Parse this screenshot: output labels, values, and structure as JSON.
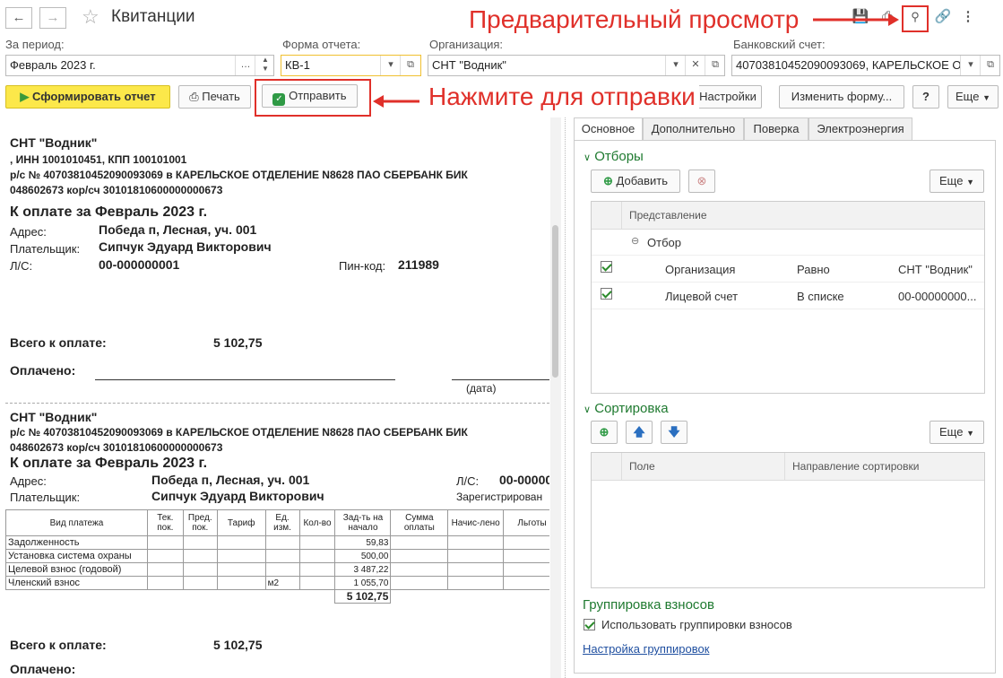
{
  "window": {
    "title": "Квитанции",
    "icons": [
      "back-arrow-icon",
      "forward-arrow-icon",
      "star-icon",
      "save-icon",
      "print-icon",
      "preview-icon",
      "link-icon",
      "more-vert-icon"
    ]
  },
  "annotations": {
    "preview": "Предварительный просмотр",
    "send": "Нажмите для отправки"
  },
  "fields": {
    "period_label": "За период:",
    "period_value": "Февраль 2023 г.",
    "form_label": "Форма отчета:",
    "form_value": "КВ-1",
    "org_label": "Организация:",
    "org_value": "СНТ \"Водник\"",
    "bank_label": "Банковский счет:",
    "bank_value": "40703810452090093069, КАРЕЛЬСКОЕ О"
  },
  "toolbar": {
    "generate": "Сформировать отчет",
    "print": "Печать",
    "send": "Отправить",
    "settings": "Настройки",
    "change_form": "Изменить форму...",
    "help": "?",
    "more": "Еще"
  },
  "report": {
    "r1": {
      "org": "СНТ \"Водник\"",
      "inn": ", ИНН 1001010451, КПП 100101001",
      "account1": "р/с № 40703810452090093069 в КАРЕЛЬСКОЕ ОТДЕЛЕНИЕ N8628 ПАО СБЕРБАНК БИК",
      "account2": "048602673 кор/сч 30101810600000000673",
      "heading": "К оплате за Февраль 2023 г.",
      "addr_label": "Адрес:",
      "addr_value": "Победа п, Лесная, уч. 001",
      "payer_label": "Плательщик:",
      "payer_value": "Сипчук Эдуард Викторович",
      "ls_label": "Л/С:",
      "ls_value": "00-000000001",
      "pin_label": "Пин-код:",
      "pin_value": "211989",
      "total_label": "Всего к оплате:",
      "total_value": "5 102,75",
      "paid_label": "Оплачено:",
      "date_label": "(дата)"
    },
    "r2": {
      "org": "СНТ \"Водник\"",
      "account1": "р/с № 40703810452090093069 в КАРЕЛЬСКОЕ ОТДЕЛЕНИЕ N8628 ПАО СБЕРБАНК БИК",
      "account2": "048602673 кор/сч 30101810600000000673",
      "heading": "К оплате за Февраль 2023 г.",
      "addr_label": "Адрес:",
      "addr_value": "Победа п, Лесная, уч. 001",
      "payer_label": "Плательщик:",
      "payer_value": "Сипчук Эдуард Викторович",
      "ls_label": "Л/С:",
      "ls_value": "00-00000",
      "registered": "Зарегистрирован",
      "total_label": "Всего к оплате:",
      "total_value": "5 102,75",
      "paid_label": "Оплачено:"
    },
    "table": {
      "headers": [
        "Вид платежа",
        "Тек. пок.",
        "Пред. пок.",
        "Тариф",
        "Ед. изм.",
        "Кол-во",
        "Зад-ть на начало",
        "Сумма оплаты",
        "Начис-лено",
        "Льготы"
      ],
      "rows": [
        {
          "name": "Задолженность",
          "unit": "",
          "debt": "59,83"
        },
        {
          "name": "Установка система охраны",
          "unit": "",
          "debt": "500,00"
        },
        {
          "name": "Целевой взнос (годовой)",
          "unit": "",
          "debt": "3 487,22"
        },
        {
          "name": "Членский взнос",
          "unit": "м2",
          "debt": "1 055,70"
        }
      ],
      "total": "5 102,75"
    }
  },
  "panel": {
    "tabs": [
      "Основное",
      "Дополнительно",
      "Поверка",
      "Электроэнергия"
    ],
    "filters_title": "Отборы",
    "add": "Добавить",
    "more": "Еще",
    "filters_col": "Представление",
    "filter_group": "Отбор",
    "filter_rows": [
      {
        "field": "Организация",
        "cond": "Равно",
        "value": "СНТ \"Водник\""
      },
      {
        "field": "Лицевой счет",
        "cond": "В списке",
        "value": "00-00000000..."
      }
    ],
    "sort_title": "Сортировка",
    "sort_col1": "Поле",
    "sort_col2": "Направление сортировки",
    "group_title": "Группировка взносов",
    "group_check": "Использовать группировки взносов",
    "group_link": "Настройка группировок"
  }
}
